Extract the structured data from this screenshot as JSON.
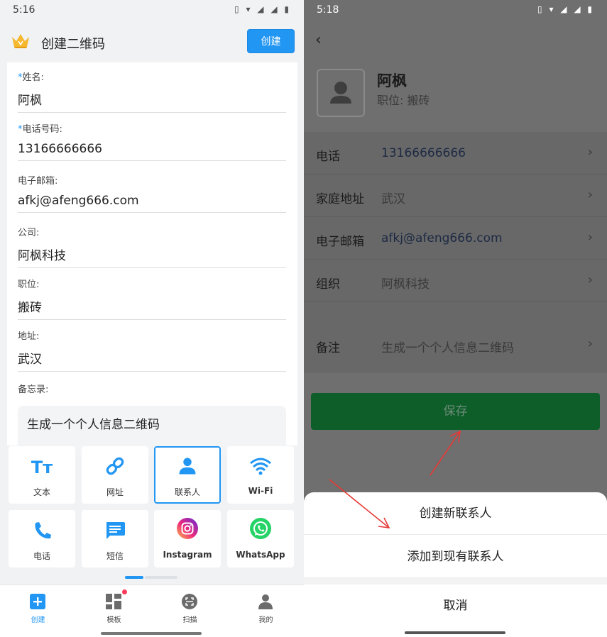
{
  "left": {
    "status": {
      "time": "5:16"
    },
    "header": {
      "title": "创建二维码",
      "create_button": "创建"
    },
    "form": {
      "fields": [
        {
          "label": "姓名:",
          "required": "*",
          "value": "阿枫"
        },
        {
          "label": "电话号码:",
          "required": "*",
          "value": "13166666666"
        },
        {
          "label": "电子邮箱:",
          "required": "",
          "value": "afkj@afeng666.com"
        },
        {
          "label": "公司:",
          "required": "",
          "value": "阿枫科技"
        },
        {
          "label": "职位:",
          "required": "",
          "value": "搬砖"
        },
        {
          "label": "地址:",
          "required": "",
          "value": "武汉"
        }
      ],
      "memo_label": "备忘录:",
      "memo_value": "生成一个个人信息二维码"
    },
    "types": [
      {
        "label": "文本",
        "icon": "text-icon"
      },
      {
        "label": "网址",
        "icon": "link-icon"
      },
      {
        "label": "联系人",
        "icon": "contact-icon",
        "active": true
      },
      {
        "label": "Wi-Fi",
        "icon": "wifi-icon"
      },
      {
        "label": "电话",
        "icon": "phone-icon"
      },
      {
        "label": "短信",
        "icon": "sms-icon"
      },
      {
        "label": "Instagram",
        "icon": "instagram-icon"
      },
      {
        "label": "WhatsApp",
        "icon": "whatsapp-icon"
      }
    ],
    "nav": [
      {
        "label": "创建",
        "icon": "plus-icon",
        "active": true
      },
      {
        "label": "模板",
        "icon": "template-icon"
      },
      {
        "label": "扫描",
        "icon": "scan-icon"
      },
      {
        "label": "我的",
        "icon": "profile-icon"
      }
    ]
  },
  "right": {
    "status": {
      "time": "5:18"
    },
    "contact": {
      "name": "阿枫",
      "job": "职位:  搬砖"
    },
    "rows": [
      {
        "key": "电话",
        "value": "13166666666",
        "link": true
      },
      {
        "key": "家庭地址",
        "value": "武汉",
        "link": false
      },
      {
        "key": "电子邮箱",
        "value": "afkj@afeng666.com",
        "link": true
      },
      {
        "key": "组织",
        "value": "阿枫科技",
        "link": false
      },
      {
        "key": "备注",
        "value": "生成一个个人信息二维码",
        "link": false
      }
    ],
    "save_button": "保存",
    "sheet": {
      "create_new": "创建新联系人",
      "add_existing": "添加到现有联系人",
      "cancel": "取消"
    }
  },
  "colors": {
    "accent": "#2196f3",
    "save_green": "#0e5e2a",
    "annotation_red": "#e53935"
  }
}
